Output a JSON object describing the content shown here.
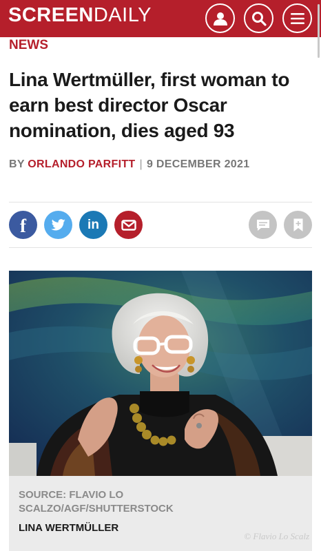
{
  "header": {
    "logo_bold": "SCREEN",
    "logo_light": "DAILY",
    "brand_color": "#b51f2b",
    "buttons": [
      {
        "icon": "user-icon"
      },
      {
        "icon": "search-icon"
      },
      {
        "icon": "hamburger-menu-icon"
      }
    ]
  },
  "article": {
    "section": "NEWS",
    "headline": "Lina Wertmüller, first woman to earn best director Oscar nomination, dies aged 93",
    "by_prefix": "BY",
    "author": "ORLANDO PARFITT",
    "separator": "|",
    "date": "9 DECEMBER 2021"
  },
  "share_bar": {
    "items": [
      {
        "icon": "facebook-icon",
        "color": "#3b5aa0"
      },
      {
        "icon": "twitter-icon",
        "color": "#55acee"
      },
      {
        "icon": "linkedin-icon",
        "color": "#1b79b5"
      },
      {
        "icon": "email-icon",
        "color": "#b51f2b"
      },
      {
        "icon": "comment-icon",
        "color": "#c4c4c4"
      },
      {
        "icon": "bookmark-icon",
        "color": "#c4c4c4"
      }
    ]
  },
  "figure": {
    "image": "portrait-photo of woman with white glasses",
    "credit": "SOURCE: FLAVIO LO SCALZO/AGF/SHUTTERSTOCK",
    "caption": "LINA WERTMÜLLER",
    "watermark": "© Flavio Lo Scalz"
  }
}
